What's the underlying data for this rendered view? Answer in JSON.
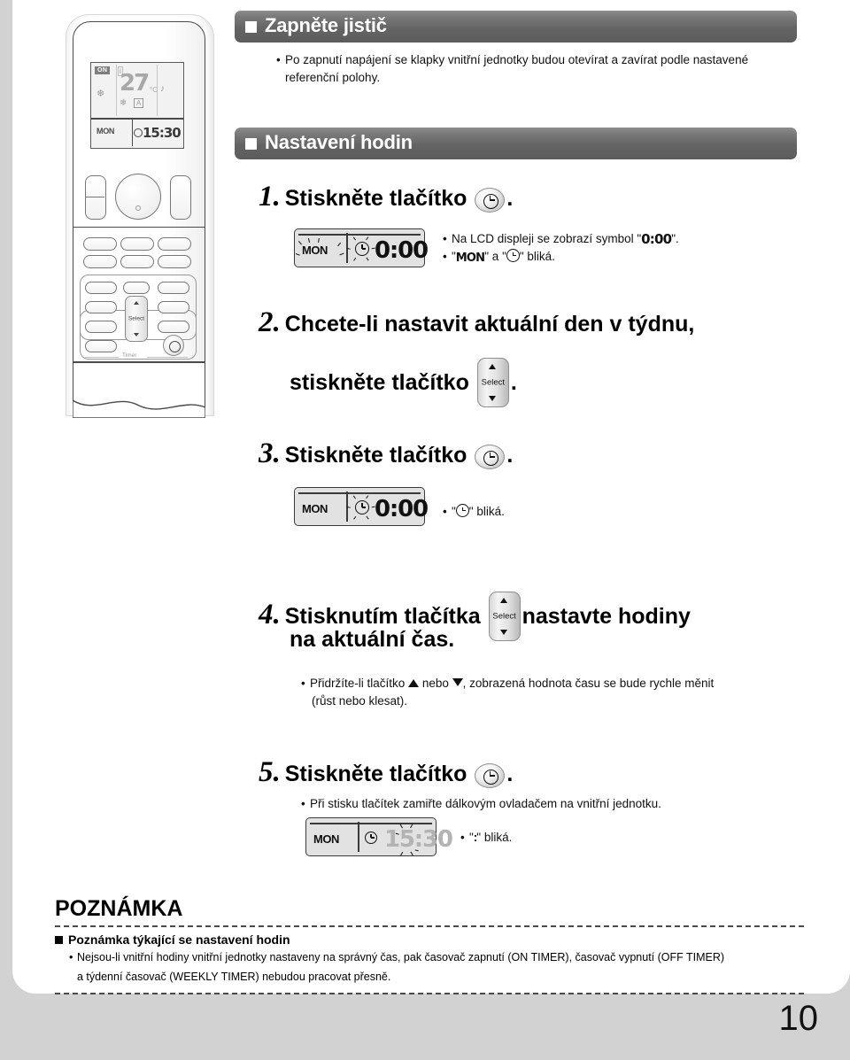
{
  "page": {
    "number": "10"
  },
  "sections": [
    {
      "id": "breaker",
      "title": "Zapněte jistič",
      "bullets": [
        "Po zapnutí napájení se klapky vnitřní jednotky budou otevírat a zavírat podle nastavené referenční polohy."
      ]
    },
    {
      "id": "clock-setting",
      "title": "Nastavení hodin"
    }
  ],
  "steps": [
    {
      "num": "1.",
      "text_before": "Stiskněte tlačítko",
      "button": "clock-button",
      "text_after": ".",
      "lcd": {
        "day": "MON",
        "time": "0:00",
        "day_blinks": true,
        "clock_blinks": true,
        "dim": false
      },
      "notes": [
        {
          "pre": "Na LCD displeji se zobrazí symbol \"",
          "lcdtext": "0:00",
          "post": "\"."
        },
        {
          "pre": "\"",
          "mon": "MON",
          "mid": "\" a \"",
          "clockicon": true,
          "post2": "\" bliká."
        }
      ]
    },
    {
      "num": "2.",
      "line1": "Chcete-li nastavit aktuální den v týdnu,",
      "line2_before": "stiskněte tlačítko",
      "button": "select-button",
      "button_label": "Select",
      "line2_after": "."
    },
    {
      "num": "3.",
      "text_before": "Stiskněte tlačítko",
      "button": "clock-button",
      "text_after": ".",
      "lcd": {
        "day": "MON",
        "time": "0:00",
        "day_blinks": false,
        "clock_blinks": true,
        "dim": false
      },
      "note": {
        "pre": "\"",
        "clockicon": true,
        "post": "\" bliká."
      }
    },
    {
      "num": "4.",
      "line1_before": "Stisknutím tlačítka",
      "button": "select-button",
      "button_label": "Select",
      "line1_after": "nastavte hodiny",
      "line2": "na aktuální čas.",
      "note_pre": "Přidržíte-li tlačítko",
      "note_mid": "nebo",
      "note_post": ", zobrazená hodnota času se bude rychle měnit",
      "note_line2": "(růst nebo klesat)."
    },
    {
      "num": "5.",
      "text_before": "Stiskněte tlačítko",
      "button": "clock-button",
      "text_after": ".",
      "note": "Při stisku tlačítek zamiřte dálkovým ovladačem na vnitřní jednotku.",
      "lcd": {
        "day": "MON",
        "time": "15:30",
        "day_blinks": false,
        "clock_blinks": false,
        "dim": true
      },
      "note2_pre": "\"",
      "note2_colon": ":",
      "note2_post": "\" bliká."
    }
  ],
  "note_box": {
    "title": "POZNÁMKA",
    "subtitle": "Poznámka týkající se nastavení hodin",
    "lines": [
      "Nejsou-li vnitřní hodiny vnitřní jednotky nastaveny na správný čas, pak časovač zapnutí (ON TIMER), časovač vypnutí (OFF TIMER)",
      "a týdenní časovač (WEEKLY TIMER) nebudou pracovat přesně."
    ]
  },
  "remote": {
    "lcd": {
      "on_badge": "ON",
      "temperature": "27",
      "unit": "°C",
      "day": "MON",
      "time": "15:30",
      "auto_badge": "A"
    },
    "select_label": "Select",
    "timer_label": "Timer"
  },
  "colors": {
    "bar_gray": "#646464",
    "page_bg": "#d2d2d2",
    "lcd_bg": "#e2e2e2",
    "ink": "#111111"
  }
}
